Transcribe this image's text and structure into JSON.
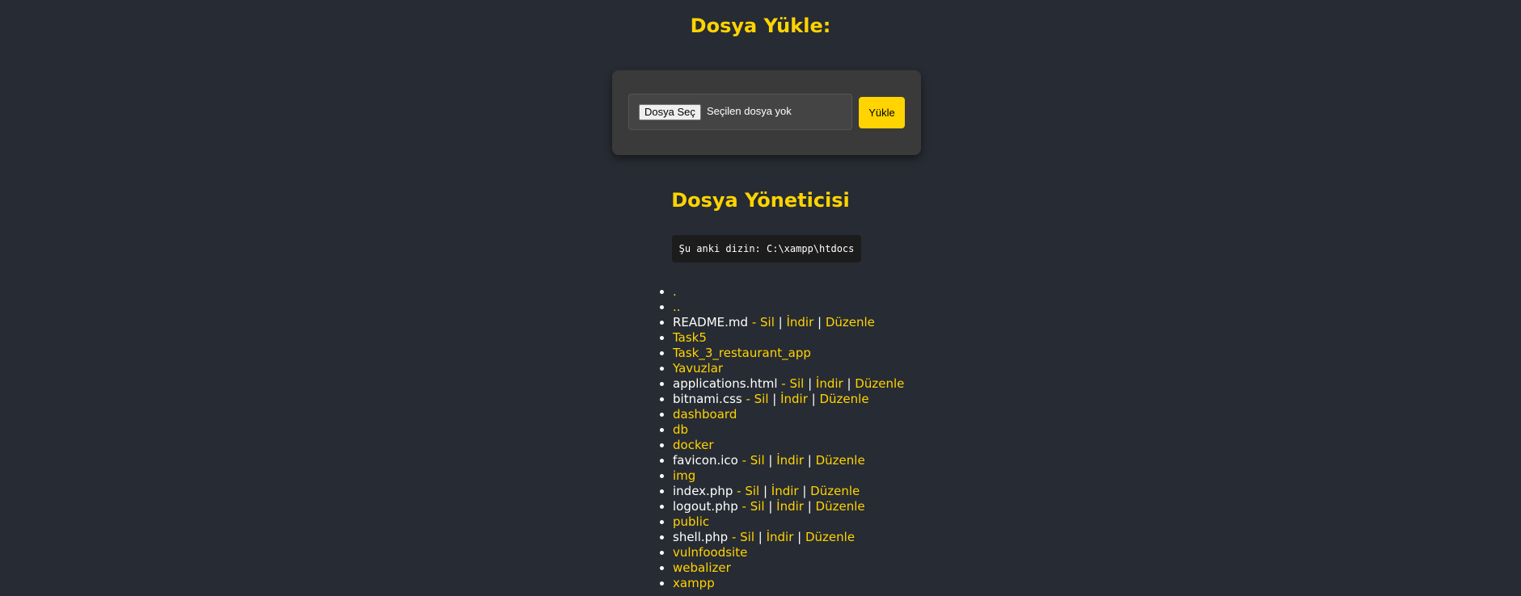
{
  "upload": {
    "title": "Dosya Yükle:",
    "choose_label": "Dosya Seç",
    "no_file_text": "Seçilen dosya yok",
    "upload_label": "Yükle"
  },
  "manager": {
    "title": "Dosya Yöneticisi",
    "current_dir": "Şu anki dizin: C:\\xampp\\htdocs"
  },
  "actions": {
    "delete": "Sil",
    "download": "İndir",
    "edit": "Düzenle",
    "dash": " - ",
    "pipe": " | "
  },
  "colors": {
    "accent": "#ffd400",
    "background": "#272b33",
    "card": "#3a3a3a"
  },
  "entries": [
    {
      "name": ".",
      "type": "dir"
    },
    {
      "name": "..",
      "type": "dir"
    },
    {
      "name": "README.md",
      "type": "file"
    },
    {
      "name": "Task5",
      "type": "dir"
    },
    {
      "name": "Task_3_restaurant_app",
      "type": "dir"
    },
    {
      "name": "Yavuzlar",
      "type": "dir"
    },
    {
      "name": "applications.html",
      "type": "file"
    },
    {
      "name": "bitnami.css",
      "type": "file"
    },
    {
      "name": "dashboard",
      "type": "dir"
    },
    {
      "name": "db",
      "type": "dir"
    },
    {
      "name": "docker",
      "type": "dir"
    },
    {
      "name": "favicon.ico",
      "type": "file"
    },
    {
      "name": "img",
      "type": "dir"
    },
    {
      "name": "index.php",
      "type": "file"
    },
    {
      "name": "logout.php",
      "type": "file"
    },
    {
      "name": "public",
      "type": "dir"
    },
    {
      "name": "shell.php",
      "type": "file"
    },
    {
      "name": "vulnfoodsite",
      "type": "dir"
    },
    {
      "name": "webalizer",
      "type": "dir"
    },
    {
      "name": "xampp",
      "type": "dir"
    }
  ]
}
